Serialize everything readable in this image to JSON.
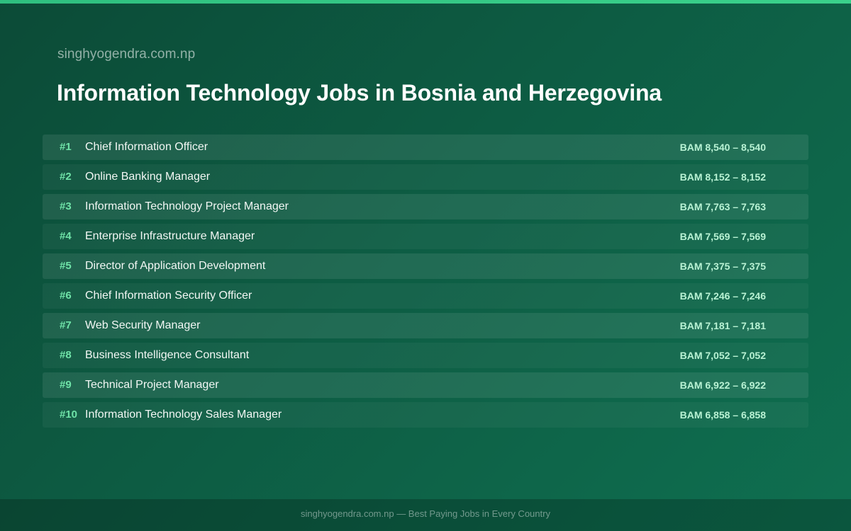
{
  "header": {
    "site_name": "singhyogendra.com.np",
    "title": "Information Technology Jobs in Bosnia and Herzegovina"
  },
  "jobs": [
    {
      "rank": "#1",
      "title": "Chief Information Officer",
      "salary": "BAM 8,540 – 8,540"
    },
    {
      "rank": "#2",
      "title": "Online Banking Manager",
      "salary": "BAM 8,152 – 8,152"
    },
    {
      "rank": "#3",
      "title": "Information Technology Project Manager",
      "salary": "BAM 7,763 – 7,763"
    },
    {
      "rank": "#4",
      "title": "Enterprise Infrastructure Manager",
      "salary": "BAM 7,569 – 7,569"
    },
    {
      "rank": "#5",
      "title": "Director of Application Development",
      "salary": "BAM 7,375 – 7,375"
    },
    {
      "rank": "#6",
      "title": "Chief Information Security Officer",
      "salary": "BAM 7,246 – 7,246"
    },
    {
      "rank": "#7",
      "title": "Web Security Manager",
      "salary": "BAM 7,181 – 7,181"
    },
    {
      "rank": "#8",
      "title": "Business Intelligence Consultant",
      "salary": "BAM 7,052 – 7,052"
    },
    {
      "rank": "#9",
      "title": "Technical Project Manager",
      "salary": "BAM 6,922 – 6,922"
    },
    {
      "rank": "#10",
      "title": "Information Technology Sales Manager",
      "salary": "BAM 6,858 – 6,858"
    }
  ],
  "footer": {
    "text": "singhyogendra.com.np — Best Paying Jobs in Every Country"
  },
  "colors": {
    "background": "#0d5c43",
    "accent": "#3ad18b",
    "rank": "#6fe3a8",
    "salary": "#b9f2d4"
  }
}
